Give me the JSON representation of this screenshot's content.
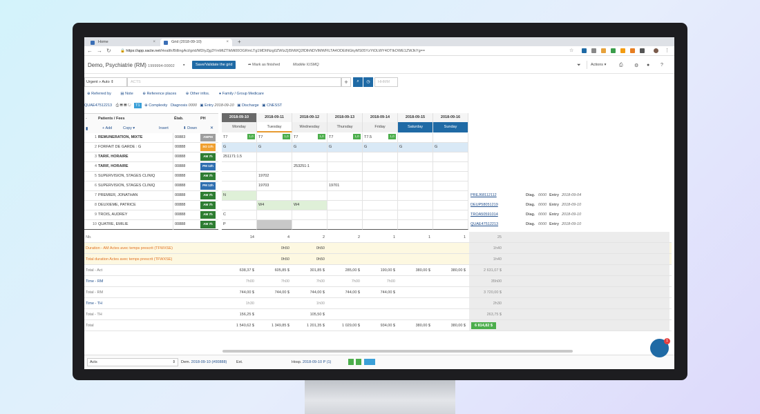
{
  "browser": {
    "tabs": [
      {
        "label": "Home"
      },
      {
        "label": "Grid (2018-09-10)"
      }
    ],
    "url_host": "https://app.xacte.net",
    "url_path": "/Health/BillingAct/grid/MDIyZjg3YmMtZTlkMi00OGRmLTg1MDItNzg0ZWIzZjI5NWQ2fDlhNDVlMWFlLTA4ODEtNGkyMS05YzYtOLWY4OTIkOWE1ZWJkYg=="
  },
  "app": {
    "title": "Demo, Psychiatrie (RM)",
    "code": "1999994-00002",
    "save_label": "Save/Validate the grid",
    "finished_label": "Mark as finished",
    "modele": "Modèle IUSMQ",
    "actions_label": "Actions"
  },
  "search": {
    "select": "Urgent » Auto",
    "placeholder": "ACTS",
    "hhmm": "HHMM"
  },
  "links": [
    "Referred by",
    "Note",
    "Reference places",
    "Other infos.",
    "Family / Group Medicare"
  ],
  "infobar": {
    "id": "QUAE47512213",
    "badge": "T1",
    "complexity": "Complexity",
    "diag_label": "Diagnosis",
    "diag": "0000",
    "entry_label": "Entry",
    "entry": "2018-09-10",
    "discharge": "Discharge",
    "cnesst": "CNESST"
  },
  "grid_header": {
    "patients": "Patients / Fees",
    "etab": "Étab.",
    "ph": "PH",
    "add": "Add",
    "copy": "Copy",
    "insert": "Insert",
    "down": "Down"
  },
  "days": [
    {
      "date": "2018-09-10",
      "name": "Monday"
    },
    {
      "date": "2018-09-11",
      "name": "Tuesday"
    },
    {
      "date": "2018-09-12",
      "name": "Wednesday"
    },
    {
      "date": "2018-09-13",
      "name": "Thursday"
    },
    {
      "date": "2018-09-14",
      "name": "Friday"
    },
    {
      "date": "2018-09-15",
      "name": "Saturday"
    },
    {
      "date": "2018-09-16",
      "name": "Sunday"
    }
  ],
  "rows": [
    {
      "n": "1",
      "name": "REMUNERATION, MIXTE",
      "etab": "00883",
      "ph": "AMPM",
      "phc": "#9e9e9e",
      "cells": [
        "T7",
        "T7",
        "T7",
        "T7",
        "T7.5",
        "",
        ""
      ],
      "badges": [
        "1,0",
        "1,0",
        "1,0",
        "1,0",
        "1,0",
        "",
        ""
      ]
    },
    {
      "n": "2",
      "name": "FORFAIT DE GARDE : G",
      "etab": "00888",
      "ph": "SO 17h",
      "phc": "#f0a030",
      "cells": [
        "G",
        "G",
        "G",
        "G",
        "G",
        "G",
        "G"
      ],
      "badges": [
        "",
        "",
        "",
        "",
        "",
        "",
        ""
      ]
    },
    {
      "n": "3",
      "name": "TARIF, HORAIRE",
      "etab": "00888",
      "ph": "AM 7h",
      "phc": "#2e7d32",
      "cells": [
        "251171:1.5",
        "",
        "",
        "",
        "",
        "",
        ""
      ],
      "badges": [
        "",
        "",
        "",
        "",
        "",
        "",
        ""
      ]
    },
    {
      "n": "4",
      "name": "TARIF, HORAIRE",
      "etab": "00888",
      "ph": "PM 12h",
      "phc": "#2f6fb0",
      "cells": [
        "",
        "",
        "253251:1",
        "",
        "",
        "",
        ""
      ],
      "badges": [
        "",
        "",
        "",
        "",
        "",
        "",
        ""
      ]
    },
    {
      "n": "5",
      "name": "SUPERVISION, STAGES CLINIQ",
      "etab": "00888",
      "ph": "AM 7h",
      "phc": "#2e7d32",
      "cells": [
        "",
        "19702",
        "",
        "",
        "",
        "",
        ""
      ],
      "badges": [
        "",
        "",
        "",
        "",
        "",
        "",
        ""
      ]
    },
    {
      "n": "6",
      "name": "SUPERVISION, STAGES CLINIQ",
      "etab": "00888",
      "ph": "PM 12h",
      "phc": "#2f6fb0",
      "cells": [
        "",
        "19703",
        "",
        "19701",
        "",
        "",
        ""
      ],
      "badges": [
        "",
        "",
        "",
        "",
        "",
        "",
        ""
      ]
    },
    {
      "n": "7",
      "name": "PREMIER, JONATHAN",
      "etab": "00888",
      "ph": "AM 7h",
      "phc": "#2e7d32",
      "cells": [
        "N",
        "",
        "",
        "",
        "",
        "",
        ""
      ],
      "badges": [
        "",
        "",
        "",
        "",
        "",
        "",
        ""
      ],
      "ref": "PREJ68112112"
    },
    {
      "n": "8",
      "name": "DEUXIEME, PATRICE",
      "etab": "00888",
      "ph": "AM 7h",
      "phc": "#2e7d32",
      "cells": [
        "",
        "W4",
        "W4",
        "",
        "",
        "",
        ""
      ],
      "badges": [
        "",
        "",
        "",
        "",
        "",
        "",
        ""
      ],
      "ref": "DEUP58051219"
    },
    {
      "n": "9",
      "name": "TROIS, AUDREY",
      "etab": "00888",
      "ph": "AM 7h",
      "phc": "#2e7d32",
      "cells": [
        "C",
        "",
        "",
        "",
        "",
        "",
        ""
      ],
      "badges": [
        "",
        "",
        "",
        "",
        "",
        "",
        ""
      ],
      "ref": "TROA50591014"
    },
    {
      "n": "10",
      "name": "QUATRE, EMILIE",
      "etab": "00888",
      "ph": "AM 7h",
      "phc": "#2e7d32",
      "cells": [
        "P",
        "",
        "",
        "",
        "",
        "",
        ""
      ],
      "badges": [
        "",
        "",
        "",
        "",
        "",
        "",
        ""
      ],
      "ref": "QUAE47512213"
    }
  ],
  "diag_text": "Diag.",
  "diag_val": "0000",
  "entry_text": "Entry",
  "entry_dates": [
    "2018-09-04",
    "2018-09-10",
    "2018-09-10",
    "2018-09-10"
  ],
  "summary": [
    {
      "label": "Nb.",
      "vals": [
        "14",
        "4",
        "2",
        "2",
        "1",
        "1",
        "1"
      ],
      "total": "25"
    },
    {
      "label": "Duration - AM Actes avec temps prescrit (TFWXSE)",
      "vals": [
        "",
        "0h50",
        "0h50",
        "",
        "",
        "",
        ""
      ],
      "total": "1h40"
    },
    {
      "label": "Total duration Actes avec temps prescrit (TFWXSE)",
      "vals": [
        "",
        "0h50",
        "0h50",
        "",
        "",
        "",
        ""
      ],
      "total": "1h40"
    },
    {
      "label": "Total - Act",
      "vals": [
        "638,37 $",
        "605,85 $",
        "301,85 $",
        "285,00 $",
        "190,00 $",
        "380,00 $",
        "380,00 $"
      ],
      "total": "2 631,07 $"
    },
    {
      "label": "Time - RM",
      "vals": [
        "7h00",
        "7h00",
        "7h00",
        "7h00",
        "7h00",
        "",
        ""
      ],
      "total": "35h00"
    },
    {
      "label": "Total - RM",
      "vals": [
        "744,00 $",
        "744,00 $",
        "744,00 $",
        "744,00 $",
        "744,00 $",
        "",
        ""
      ],
      "total": "3 720,00 $"
    },
    {
      "label": "Time - TH",
      "vals": [
        "1h30",
        "",
        "1h00",
        "",
        "",
        "",
        ""
      ],
      "total": "2h30"
    },
    {
      "label": "Total - TH",
      "vals": [
        "156,25 $",
        "",
        "105,50 $",
        "",
        "",
        "",
        ""
      ],
      "total": "263,75 $"
    },
    {
      "label": "Total",
      "vals": [
        "1 540,62 $",
        "1 349,85 $",
        "1 201,35 $",
        "1 029,00 $",
        "934,00 $",
        "380,00 $",
        "380,00 $"
      ],
      "total": "6 814,82 $"
    }
  ],
  "bottom": {
    "select": "Acts",
    "dem_label": "Dem.",
    "dem": "2018-09-10 (#00888)",
    "ext": "Ext.",
    "hosp_label": "Hosp.",
    "hosp": "2018-09-10 P (1)"
  },
  "chat_badge": "1"
}
